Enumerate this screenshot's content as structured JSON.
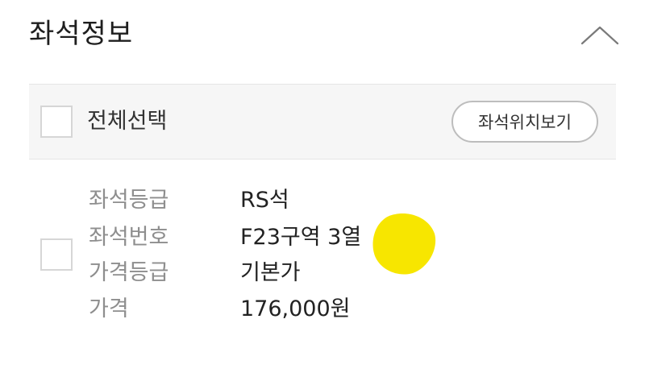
{
  "section": {
    "title": "좌석정보"
  },
  "select_all": {
    "label": "전체선택",
    "checked": false
  },
  "seat_map_button": {
    "label": "좌석위치보기"
  },
  "seat_details": [
    {
      "label": "좌석등급",
      "value": "RS석"
    },
    {
      "label": "좌석번호",
      "value": "F23구역 3열"
    },
    {
      "label": "가격등급",
      "value": "기본가"
    },
    {
      "label": "가격",
      "value": "176,000원"
    }
  ],
  "seat_checked": false,
  "icons": {
    "collapse": "chevron-up-icon"
  },
  "colors": {
    "highlight": "#f7e600",
    "bar_background": "#f6f6f6",
    "label_gray": "#8e8e8e"
  }
}
